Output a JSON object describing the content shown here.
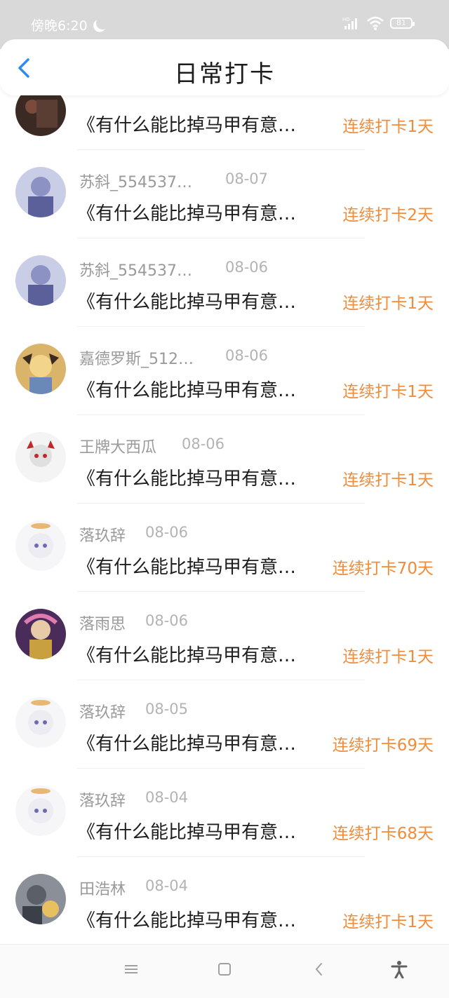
{
  "status_bar": {
    "time": "傍晚6:20",
    "battery": "81",
    "icons": [
      "moon-icon",
      "hd-signal-icon",
      "wifi-icon",
      "battery-icon"
    ]
  },
  "header": {
    "title": "日常打卡",
    "back_icon": "chevron-left-icon"
  },
  "checkins": [
    {
      "name": "",
      "date": "",
      "title": "《有什么能比掉马甲有意…",
      "streak": "连续打卡1天"
    },
    {
      "name": "苏斜_554537…",
      "date": "08-07",
      "title": "《有什么能比掉马甲有意…",
      "streak": "连续打卡2天"
    },
    {
      "name": "苏斜_554537…",
      "date": "08-06",
      "title": "《有什么能比掉马甲有意…",
      "streak": "连续打卡1天"
    },
    {
      "name": "嘉德罗斯_512…",
      "date": "08-06",
      "title": "《有什么能比掉马甲有意…",
      "streak": "连续打卡1天"
    },
    {
      "name": "王牌大西瓜",
      "date": "08-06",
      "title": "《有什么能比掉马甲有意…",
      "streak": "连续打卡1天"
    },
    {
      "name": "落玖辞",
      "date": "08-06",
      "title": "《有什么能比掉马甲有意…",
      "streak": "连续打卡70天"
    },
    {
      "name": "落雨思",
      "date": "08-06",
      "title": "《有什么能比掉马甲有意…",
      "streak": "连续打卡1天"
    },
    {
      "name": "落玖辞",
      "date": "08-05",
      "title": "《有什么能比掉马甲有意…",
      "streak": "连续打卡69天"
    },
    {
      "name": "落玖辞",
      "date": "08-04",
      "title": "《有什么能比掉马甲有意…",
      "streak": "连续打卡68天"
    },
    {
      "name": "田浩林",
      "date": "08-04",
      "title": "《有什么能比掉马甲有意…",
      "streak": "连续打卡1天"
    }
  ],
  "colors": {
    "accent_orange": "#f08c3a",
    "back_blue": "#2d8cf0",
    "name_gray": "#9a9a9a"
  },
  "nav_bar": {
    "items": [
      "menu-icon",
      "home-square-icon",
      "back-triangle-icon",
      "accessibility-icon"
    ]
  }
}
